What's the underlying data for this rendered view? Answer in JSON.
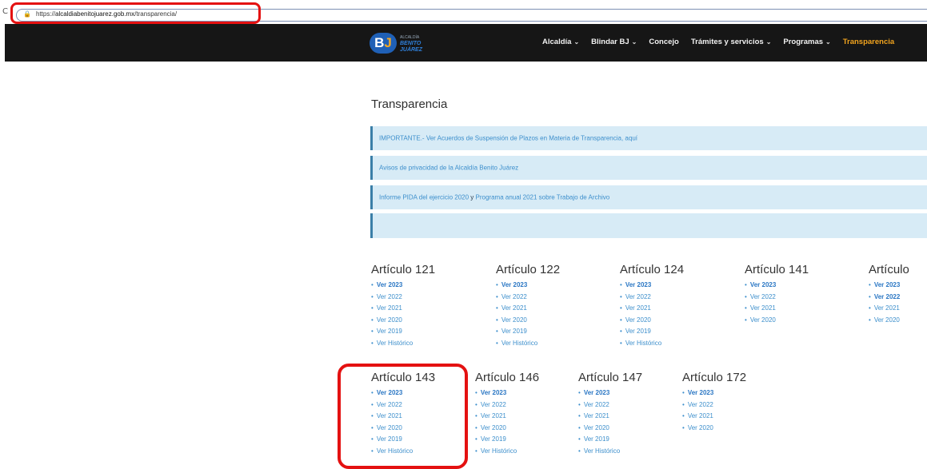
{
  "browser": {
    "left_glyph": "C",
    "url_prefix": "https://",
    "url_domain": "alcaldiabenitojuarez.gob.mx",
    "url_path": "/transparencia/"
  },
  "logo": {
    "mark_b": "B",
    "mark_j": "J",
    "line_small": "ALCALDÍA",
    "line1": "BENITO",
    "line2": "JUÁREZ"
  },
  "nav": [
    {
      "label": "Alcaldía",
      "dropdown": true
    },
    {
      "label": "Blindar BJ",
      "dropdown": true
    },
    {
      "label": "Concejo",
      "dropdown": false
    },
    {
      "label": "Trámites y servicios",
      "dropdown": true
    },
    {
      "label": "Programas",
      "dropdown": true
    },
    {
      "label": "Transparencia",
      "dropdown": false,
      "active": true
    }
  ],
  "page_title": "Transparencia",
  "notices": [
    {
      "text": "IMPORTANTE.- Ver Acuerdos de Suspensión de Plazos en Materia de Transparencia, aquí"
    },
    {
      "text": "Avisos de privacidad de la Alcaldía Benito Juárez"
    },
    {
      "text_a": "Informe PIDA del ejercicio 2020",
      "text_b": " y ",
      "text_c": "Programa anual 2021 sobre Trabajo de Archivo"
    },
    {
      "text": ""
    }
  ],
  "articles": [
    {
      "title": "Artículo 121",
      "links": [
        {
          "label": "Ver 2023",
          "bold": true
        },
        {
          "label": "Ver 2022"
        },
        {
          "label": "Ver 2021"
        },
        {
          "label": "Ver 2020"
        },
        {
          "label": "Ver 2019"
        },
        {
          "label": "Ver Histórico"
        }
      ]
    },
    {
      "title": "Artículo 122",
      "links": [
        {
          "label": "Ver 2023",
          "bold": true
        },
        {
          "label": "Ver 2022"
        },
        {
          "label": "Ver 2021"
        },
        {
          "label": "Ver 2020"
        },
        {
          "label": "Ver 2019"
        },
        {
          "label": "Ver Histórico"
        }
      ]
    },
    {
      "title": "Artículo 124",
      "links": [
        {
          "label": "Ver 2023",
          "bold": true
        },
        {
          "label": "Ver 2022"
        },
        {
          "label": "Ver 2021"
        },
        {
          "label": "Ver 2020"
        },
        {
          "label": "Ver 2019"
        },
        {
          "label": "Ver Histórico"
        }
      ]
    },
    {
      "title": "Artículo 141",
      "links": [
        {
          "label": "Ver 2023",
          "bold": true
        },
        {
          "label": "Ver 2022"
        },
        {
          "label": "Ver 2021"
        },
        {
          "label": "Ver 2020"
        }
      ]
    },
    {
      "title": "Artículo",
      "links": [
        {
          "label": "Ver 2023",
          "bold": true
        },
        {
          "label": "Ver 2022",
          "bold": true
        },
        {
          "label": "Ver 2021"
        },
        {
          "label": "Ver 2020"
        }
      ]
    },
    {
      "title": "Artículo 143",
      "links": [
        {
          "label": "Ver 2023",
          "bold": true
        },
        {
          "label": "Ver 2022"
        },
        {
          "label": "Ver 2021"
        },
        {
          "label": "Ver 2020"
        },
        {
          "label": "Ver 2019"
        },
        {
          "label": "Ver Histórico"
        }
      ]
    },
    {
      "title": "Artículo 146",
      "links": [
        {
          "label": "Ver 2023",
          "bold": true
        },
        {
          "label": "Ver 2022"
        },
        {
          "label": "Ver 2021"
        },
        {
          "label": "Ver 2020"
        },
        {
          "label": "Ver 2019"
        },
        {
          "label": "Ver Histórico"
        }
      ]
    },
    {
      "title": "Artículo 147",
      "links": [
        {
          "label": "Ver 2023",
          "bold": true
        },
        {
          "label": "Ver 2022"
        },
        {
          "label": "Ver 2021"
        },
        {
          "label": "Ver 2020"
        },
        {
          "label": "Ver 2019"
        },
        {
          "label": "Ver Histórico"
        }
      ]
    },
    {
      "title": "Artículo 172",
      "links": [
        {
          "label": "Ver 2023",
          "bold": true
        },
        {
          "label": "Ver 2022"
        },
        {
          "label": "Ver 2021"
        },
        {
          "label": "Ver 2020"
        }
      ]
    }
  ],
  "colors": {
    "accent": "#f2a41e",
    "link": "#3d8fcc",
    "highlight": "#e41111",
    "notice_bg": "#d7ebf6",
    "navbar_bg": "#161616"
  }
}
